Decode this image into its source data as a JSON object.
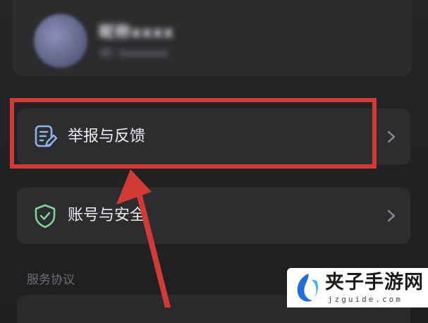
{
  "profile": {
    "name": "昵称xxxx",
    "subtitle": "ID: xxxxxxxx"
  },
  "menu": {
    "report_label": "举报与反馈",
    "report_icon": "document-edit-icon",
    "account_label": "账号与安全",
    "account_icon": "shield-check-icon",
    "chevron_icon": "chevron-right-icon"
  },
  "sections": {
    "service_header": "服务协议"
  },
  "annotation": {
    "color": "#d23a35"
  },
  "colors": {
    "report_icon": "#8fb3e8",
    "account_icon": "#7bd39a"
  },
  "watermark": {
    "title": "夹子手游网",
    "url": "jzguide.com"
  }
}
